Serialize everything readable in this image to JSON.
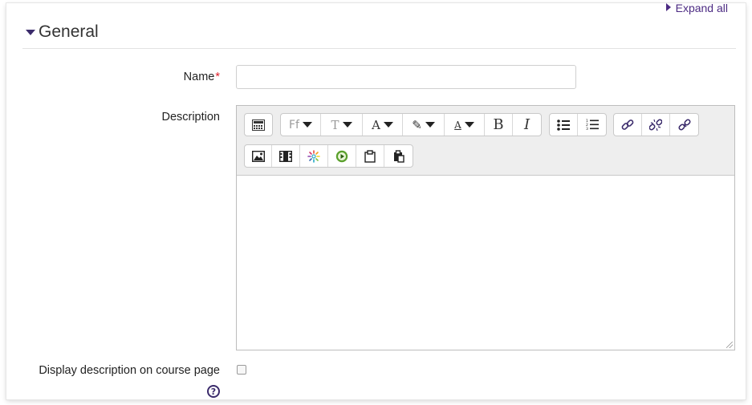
{
  "header": {
    "expand_all": "Expand all"
  },
  "section": {
    "title": "General"
  },
  "form": {
    "name_label": "Name",
    "required_mark": "*",
    "name_value": "",
    "description_label": "Description",
    "display_label": "Display description on course page",
    "display_checked": false
  },
  "editor": {
    "toolbar_row1": [
      {
        "icon": "toolbar-toggle-icon"
      },
      {
        "icon": "font-family-icon",
        "text": "Ff"
      },
      {
        "icon": "font-size-icon",
        "text": "T"
      },
      {
        "icon": "font-color-icon",
        "text": "A"
      },
      {
        "icon": "highlight-icon",
        "text": "✎"
      },
      {
        "icon": "style-icon",
        "text": "A"
      },
      {
        "icon": "bold-icon",
        "text": "B"
      },
      {
        "icon": "italic-icon",
        "text": "I"
      },
      {
        "icon": "unordered-list-icon"
      },
      {
        "icon": "ordered-list-icon"
      },
      {
        "icon": "link-icon"
      },
      {
        "icon": "unlink-icon"
      },
      {
        "icon": "anchor-link-icon"
      }
    ],
    "toolbar_row2": [
      {
        "icon": "image-icon"
      },
      {
        "icon": "media-icon"
      },
      {
        "icon": "kaltura-icon"
      },
      {
        "icon": "video-play-icon"
      },
      {
        "icon": "paste-icon"
      },
      {
        "icon": "paste-special-icon"
      }
    ],
    "content": ""
  },
  "colors": {
    "accent": "#4c2b83",
    "required": "#e0202b"
  }
}
